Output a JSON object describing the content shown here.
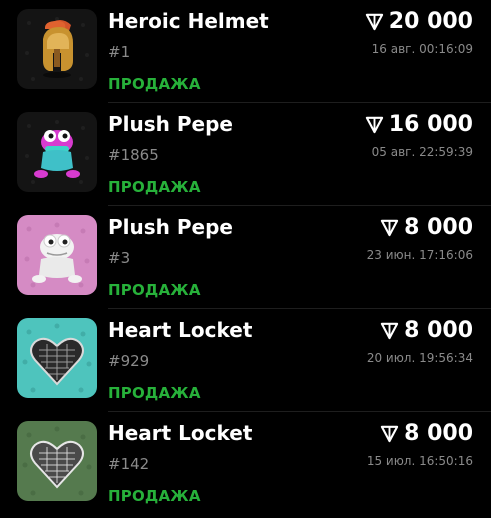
{
  "colors": {
    "background": "#000000",
    "status_green": "#27b13a",
    "secondary_text": "#8a8a8a"
  },
  "items": [
    {
      "name": "Heroic Helmet",
      "number": "#1",
      "price": "20 000",
      "date": "16 авг. 00:16:09",
      "status": "ПРОДАЖА",
      "icon": "heroic-helmet-icon"
    },
    {
      "name": "Plush Pepe",
      "number": "#1865",
      "price": "16 000",
      "date": "05 авг. 22:59:39",
      "status": "ПРОДАЖА",
      "icon": "plush-pepe-icon"
    },
    {
      "name": "Plush Pepe",
      "number": "#3",
      "price": "8 000",
      "date": "23 июн. 17:16:06",
      "status": "ПРОДАЖА",
      "icon": "plush-pepe-icon"
    },
    {
      "name": "Heart Locket",
      "number": "#929",
      "price": "8 000",
      "date": "20 июл. 19:56:34",
      "status": "ПРОДАЖА",
      "icon": "heart-locket-icon"
    },
    {
      "name": "Heart Locket",
      "number": "#142",
      "price": "8 000",
      "date": "15 июл. 16:50:16",
      "status": "ПРОДАЖА",
      "icon": "heart-locket-icon"
    }
  ]
}
